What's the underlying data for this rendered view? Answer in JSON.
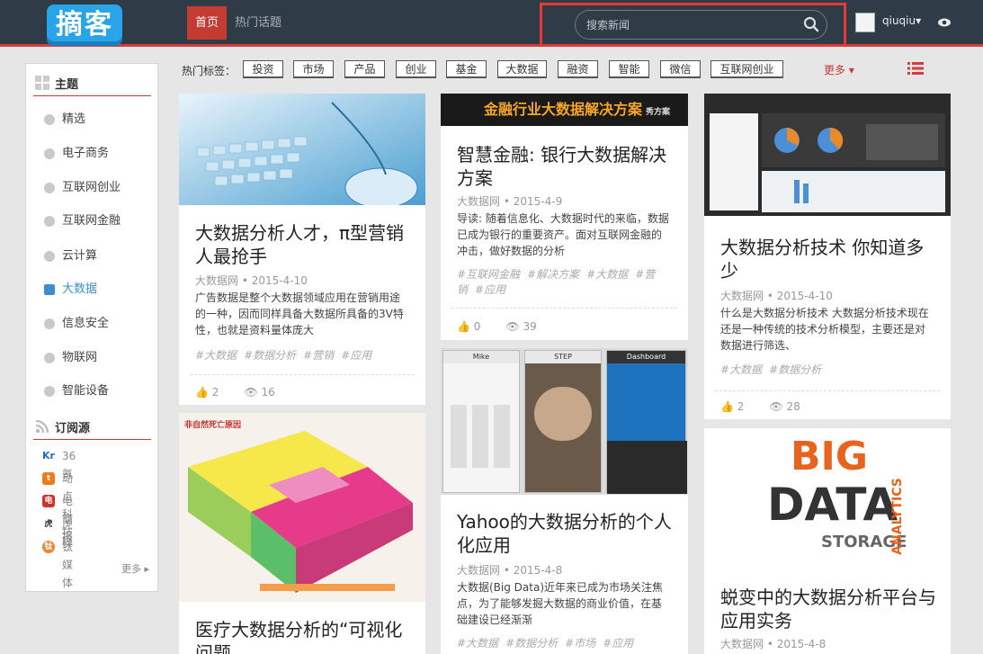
{
  "header": {
    "logo": "摘客",
    "nav": [
      "首页",
      "热门话题"
    ],
    "search_placeholder": "搜索新闻",
    "username": "qiuqiu▾",
    "colors": {
      "bg": "#2f3b46",
      "accent": "#c33b32",
      "highlight": "#e53935"
    }
  },
  "sidebar": {
    "topics_title": "主题",
    "topics": [
      {
        "label": "精选",
        "icon": "star-icon"
      },
      {
        "label": "电子商务",
        "icon": "bag-icon"
      },
      {
        "label": "互联网创业",
        "icon": "flag-icon"
      },
      {
        "label": "互联网金融",
        "icon": "money-icon"
      },
      {
        "label": "云计算",
        "icon": "cloud-icon"
      },
      {
        "label": "大数据",
        "icon": "database-icon",
        "active": true
      },
      {
        "label": "信息安全",
        "icon": "shield-icon"
      },
      {
        "label": "物联网",
        "icon": "globe-icon"
      },
      {
        "label": "智能设备",
        "icon": "hand-icon"
      }
    ],
    "feeds_title": "订阅源",
    "feeds": [
      {
        "label": "36氪",
        "badge": "Kr"
      },
      {
        "label": "动点科技",
        "badge": "t"
      },
      {
        "label": "电商报",
        "badge": "电"
      },
      {
        "label": "虎嗅",
        "badge": "虎"
      },
      {
        "label": "钛媒体",
        "badge": "钛"
      }
    ],
    "more": "更多 ▸"
  },
  "tags": {
    "label": "热门标签：",
    "items": [
      "投资",
      "市场",
      "产品",
      "创业",
      "基金",
      "大数据",
      "融资",
      "智能",
      "微信",
      "互联网创业"
    ],
    "more": "更多 ▾"
  },
  "cards": [
    {
      "title": "大数据分析人才，π型营销人最抢手",
      "source": "大数据网",
      "date": "2015-4-10",
      "summary": "广告数据是整个大数据领域应用在营销用途的一种，因而同样具备大数据所具备的3V特性，也就是资料量体庞大",
      "tags": [
        "#大数据",
        "#数据分析",
        "#营销",
        "#应用"
      ],
      "likes": "2",
      "views": "16"
    },
    {
      "banner": "金融行业大数据解决方案",
      "banner_sub": "秀方案",
      "title": "智慧金融: 银行大数据解决方案",
      "source": "大数据网",
      "date": "2015-4-9",
      "summary": "导读: 随着信息化、大数据时代的来临，数据已成为银行的重要资产。面对互联网金融的冲击，做好数据的分析",
      "tags": [
        "#互联网金融",
        "#解决方案",
        "#大数据",
        "#营销",
        "#应用"
      ],
      "likes": "0",
      "views": "39"
    },
    {
      "title": "大数据分析技术 你知道多少",
      "source": "大数据网",
      "date": "2015-4-10",
      "summary": "什么是大数据分析技术 大数据分析技术现在还是一种传统的技术分析模型，主要还是对数据进行筛选、",
      "tags": [
        "#大数据",
        "#数据分析"
      ],
      "likes": "2",
      "views": "28"
    },
    {
      "title": "医疗大数据分析的“可视化问题",
      "image_title": "非自然死亡原因"
    },
    {
      "title": "Yahoo的大数据分析的个人化应用",
      "source": "大数据网",
      "date": "2015-4-8",
      "summary": "大数据(Big Data)近年来已成为市场关注焦点，为了能够发掘大数据的商业价值，在基础建设已经渐渐",
      "tags": [
        "#大数据",
        "#数据分析",
        "#市场",
        "#应用"
      ],
      "phone_labels": [
        "Mike",
        "STEP",
        "Dashboard"
      ]
    },
    {
      "title": "蜕变中的大数据分析平台与应用实务",
      "source": "大数据网",
      "date": "2015-4-8",
      "wordcloud": [
        "BIG",
        "DATA",
        "STORAGE",
        "ANALYTICS"
      ]
    }
  ]
}
